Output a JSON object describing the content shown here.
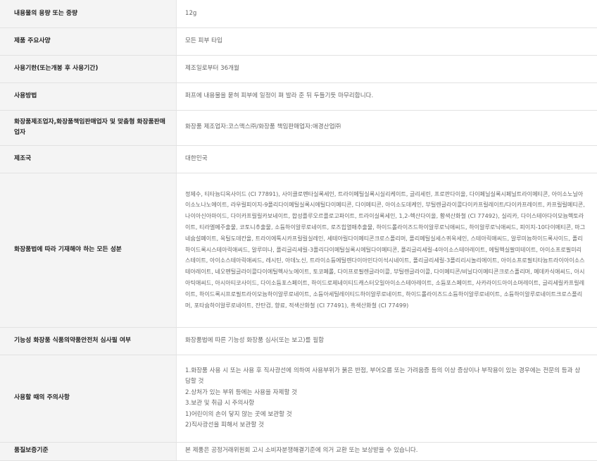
{
  "rows": [
    {
      "label": "내용물의 용량 또는 중량",
      "value": "12g"
    },
    {
      "label": "제품 주요사양",
      "value": "모든 피부 타입"
    },
    {
      "label": "사용기한(또는개봉 후 사용기간)",
      "value": "제조일로부터 36개월"
    },
    {
      "label": "사용방법",
      "value": "퍼프에 내용물을 묻혀 피부에 일정이 펴 발라 준 뒤 두들기듯 마무리합니다."
    },
    {
      "label": "화장품제조업자,화장품책임판매업자 및 맞춤형 화장품판매업자",
      "value": "화장품 제조업자:코스맥스㈜/화장품 책임판매업자:애경산업㈜"
    },
    {
      "label": "제조국",
      "value": "대한민국"
    },
    {
      "label": "화장품법에 따라 기재해야 하는 모든 성분",
      "value": "정제수, 티타늄디옥사이드 (CI 77891), 사이클로펜타실록세인, 트라이메틸실록시실리케이트, 글리세린, 프로판다이올, 다이페닐실록시페닐트라이메티콘, 아이소노닐아이소노나노에이트, 라우릴피이지-9폴리다이메틸실록시에틸다이메티콘, 다이메티콘, 아이소도데케인, 부틸렌글라이콜다이카프릴레이트/다이카프레이트, 카프릴릴메티콘, 나이아신아마이드, 다이카프릴릴카보네이트, 합성플루오르플로고파이트, 트라이실록세인, 1,2-헥산다이올, 황색산화철 (CI 77492), 실리카, 다이스테아다이모늄헥토라이트, 티라엘메주출물, 코토니추출물, 소듐하이알루로네이트, 로즈힙열매추출물, 하이드롤라이즈드하이알루로닉애씨드, 하이알루로닉애씨드, 피이지-10다이메티콘, 마그네슘설페이트, 옥틸도데칸올, 트라이에톡시카프릴릴실레인, 세테아릴다이메티콘크로스폴리머, 폴리메틸실세스퀴옥세인, 스테아릭애씨드, 알루미늄하이드록사이드, 폴리하이드록시스테아릭애씨드, 알루미나, 폴리글리세릴-3폴리다이메틸실록시에틸다이메티콘, 폴리글리세릴-4아이소스테아레이트, 에틸헥실팔미테이트, 아이소프로필미리스테이트, 아이소스테아릭애씨드, 레시틴, 아데노신, 트라이소듐에틸렌다이아민다이석시네이트, 폴리글리세릴-3폴리리시놀리에이트, 아이소프로필티타늄트라이아이소스테아레이트, 네오펜틸글라이콜다이에틸헥사노에이트, 토코페롤, 다이프로필렌글라이콜, 부틸렌글라이콜, 다이메티콘/비닐다이메티콘크로스폴리머, 메데카식애씨드, 아시아틱애씨드, 아시아티코사이드, 다이소듐포스페이트, 하이드로제네이티드캐스터오일아이소스테아레이트, 소듐포스페이트, 사카라이드아이소머레이트, 글리세릴카프릴레이트, 하이드록시프로필트라이모늄하이알루로네이트, 소듐아세틸레이티드하이알루로네이트, 하이드롤라이즈드소듐하이알루로네이트, 소듐하이알루로네이트크로스폴리머, 포타슘하이알루로네이트, 잔탄검, 향료, 적색산화철 (CI 77491), 흑색산화철 (CI 77499)"
    },
    {
      "label": "기능성 화장품 식품의약품안전처 심사필 여부",
      "value": "화장품법에 따른 기능성 화장품 심사(또는 보고)를 필함"
    },
    {
      "label": "사용할 때의 주의사항",
      "lines": [
        "1.화장품 사용 시 또는 사용 후 직사광선에 의하여 사용부위가 붉은 반점, 부어오름 또는 가려움증 등의 이상 증상이나 부작용이 있는 경우에는 전문의 등과 상담할 것",
        "2.상처가 있는 부위 등에는 사용을 자제할 것",
        "3.보관 및 취급 시 주의사항",
        "1)어린이의 손이 닿지 않는 곳에 보관할 것",
        "2)직사광선을 피해서 보관할 것"
      ]
    },
    {
      "label": "품질보증기준",
      "value": "본 제품은 공정거래위원회 고시 소비자분쟁해결기준에 의거 교환 또는 보상받을 수 있습니다."
    }
  ]
}
